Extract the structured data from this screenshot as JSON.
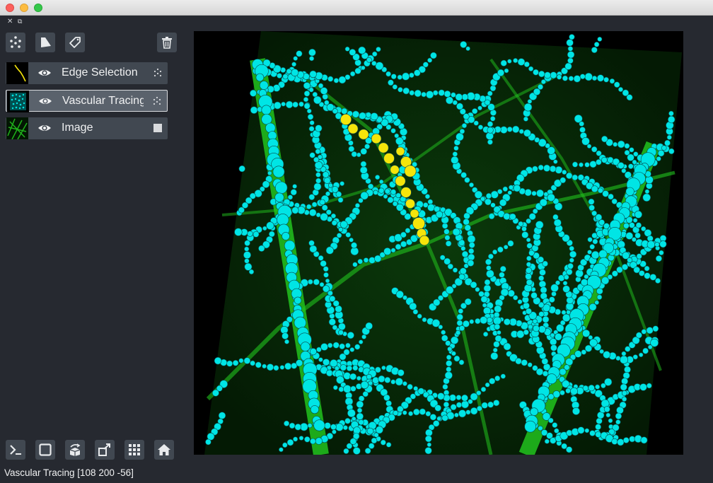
{
  "window": {
    "traffic_lights": [
      "close",
      "minimize",
      "zoom"
    ]
  },
  "dock": {
    "close_glyph": "✕",
    "float_glyph": "⧉"
  },
  "layer_controls": [
    {
      "name": "new-points-layer-button",
      "icon": "points-icon"
    },
    {
      "name": "new-shapes-layer-button",
      "icon": "shapes-icon"
    },
    {
      "name": "new-labels-layer-button",
      "icon": "labels-tag-icon"
    },
    {
      "name": "delete-layer-button",
      "icon": "trash-icon"
    }
  ],
  "layers": [
    {
      "name": "Edge Selection",
      "visible": true,
      "type_icon": "points-icon",
      "selected": false
    },
    {
      "name": "Vascular Tracing",
      "visible": true,
      "type_icon": "points-icon",
      "selected": true
    },
    {
      "name": "Image",
      "visible": true,
      "type_icon": "image-icon",
      "selected": false
    }
  ],
  "viewer_buttons": [
    {
      "name": "console-button",
      "icon": "console-icon"
    },
    {
      "name": "ndisplay-button",
      "icon": "square-icon"
    },
    {
      "name": "roll-dimensions-button",
      "icon": "roll-icon"
    },
    {
      "name": "transpose-button",
      "icon": "transpose-icon"
    },
    {
      "name": "grid-mode-button",
      "icon": "grid-icon"
    },
    {
      "name": "reset-view-button",
      "icon": "home-icon"
    }
  ],
  "colors": {
    "background": "#262930",
    "panel": "#414851",
    "tracing_points": "#00e5e5",
    "edge_points": "#f5e50a",
    "image": "#22c31e"
  },
  "status": "Vascular Tracing [108 200 -56]"
}
